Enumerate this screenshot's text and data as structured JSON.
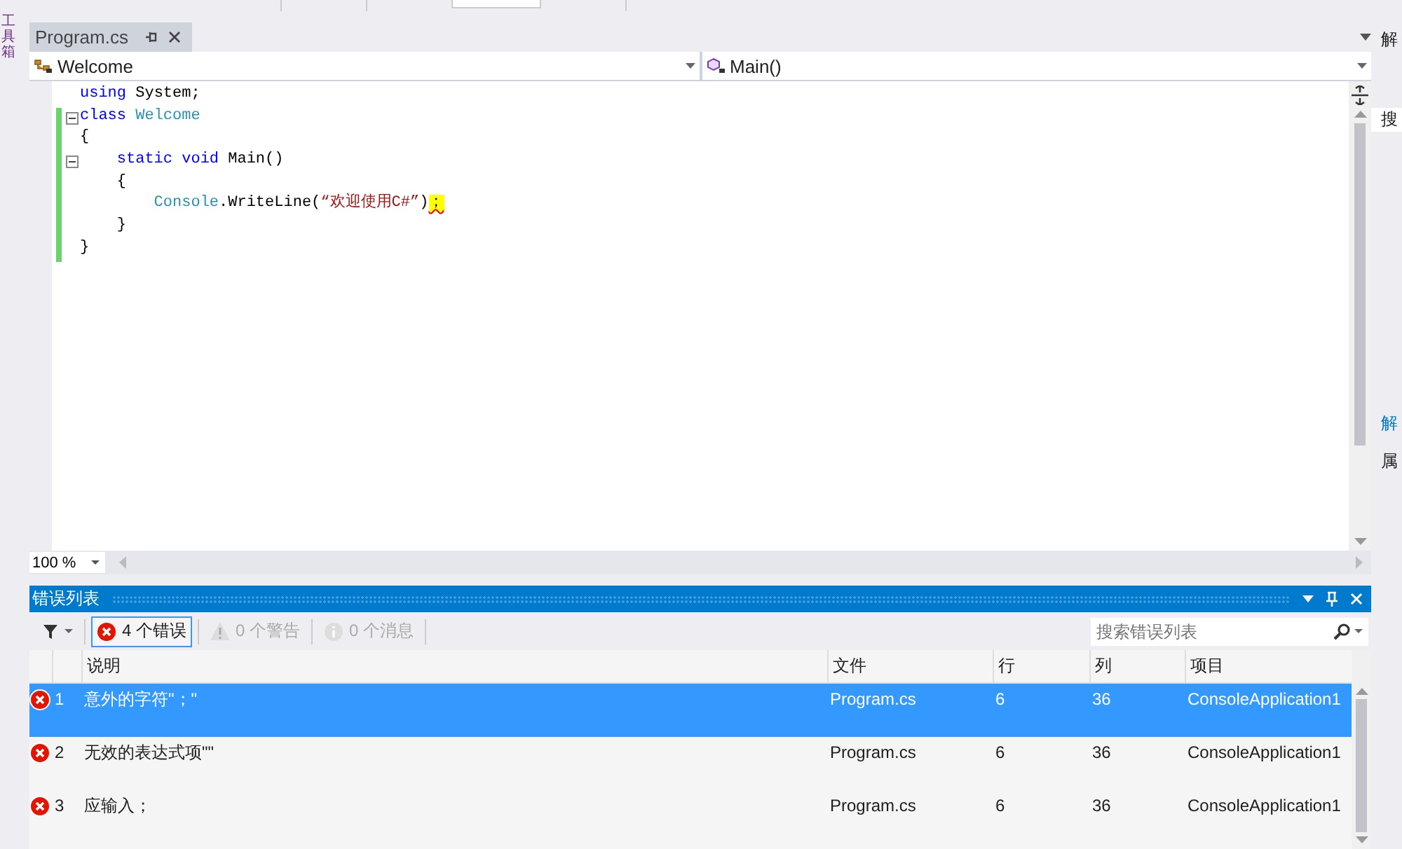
{
  "toolbox": {
    "label": "工具箱"
  },
  "right_panel": {
    "items": [
      {
        "kind": "title",
        "text": "解"
      },
      {
        "kind": "search",
        "text": "搜"
      },
      {
        "kind": "link",
        "text": "解"
      },
      {
        "kind": "title",
        "text": "属"
      }
    ]
  },
  "tabs": [
    {
      "label": "Program.cs",
      "selected": true
    }
  ],
  "navigation": {
    "type": "Welcome",
    "member": "Main()"
  },
  "code": [
    [
      {
        "kind": "keyword",
        "text": "using"
      },
      {
        "kind": "plain",
        "text": " System;"
      }
    ],
    [
      {
        "kind": "keyword",
        "text": "class"
      },
      {
        "kind": "type",
        "text": " Welcome"
      }
    ],
    [
      {
        "kind": "plain",
        "text": "{"
      }
    ],
    [
      {
        "kind": "keyword",
        "text": "    static"
      },
      {
        "kind": "keyword",
        "text": " void"
      },
      {
        "kind": "plain",
        "text": " Main()"
      }
    ],
    [
      {
        "kind": "plain",
        "text": "    {"
      }
    ],
    [
      {
        "kind": "type",
        "text": "        Console"
      },
      {
        "kind": "plain",
        "text": ".WriteLine("
      },
      {
        "kind": "string",
        "text": "“欢迎使用C#”"
      },
      {
        "kind": "plain",
        "text": ")"
      },
      {
        "kind": "error",
        "text": "；"
      }
    ],
    [
      {
        "kind": "plain",
        "text": "    }"
      }
    ],
    [
      {
        "kind": "plain",
        "text": "}"
      }
    ]
  ],
  "outline": [
    {
      "collapsible": false,
      "changed": false
    },
    {
      "collapsible": true,
      "changed": true
    },
    {
      "collapsible": false,
      "changed": true
    },
    {
      "collapsible": true,
      "changed": true
    },
    {
      "collapsible": false,
      "changed": true
    },
    {
      "collapsible": false,
      "changed": true
    },
    {
      "collapsible": false,
      "changed": true
    },
    {
      "collapsible": false,
      "changed": true
    }
  ],
  "zoom": "100 %",
  "error_list": {
    "title": "错误列表",
    "filters": [
      {
        "kind": "error",
        "label": "4 个错误",
        "selected": true,
        "disabled": false
      },
      {
        "kind": "warning",
        "label": "0 个警告",
        "selected": false,
        "disabled": true
      },
      {
        "kind": "message",
        "label": "0 个消息",
        "selected": false,
        "disabled": true
      }
    ],
    "search": {
      "placeholder": "搜索错误列表"
    },
    "columns": [
      "说明",
      "文件",
      "行",
      "列",
      "项目"
    ],
    "rows": [
      {
        "number": "1",
        "description": "意外的字符\"；\"",
        "file": "Program.cs",
        "line": "6",
        "column": "36",
        "project": "ConsoleApplication1",
        "selected": true
      },
      {
        "number": "2",
        "description": "无效的表达式项\"\"",
        "file": "Program.cs",
        "line": "6",
        "column": "36",
        "project": "ConsoleApplication1",
        "selected": false
      },
      {
        "number": "3",
        "description": "应输入；",
        "file": "Program.cs",
        "line": "6",
        "column": "36",
        "project": "ConsoleApplication1",
        "selected": false
      }
    ]
  }
}
